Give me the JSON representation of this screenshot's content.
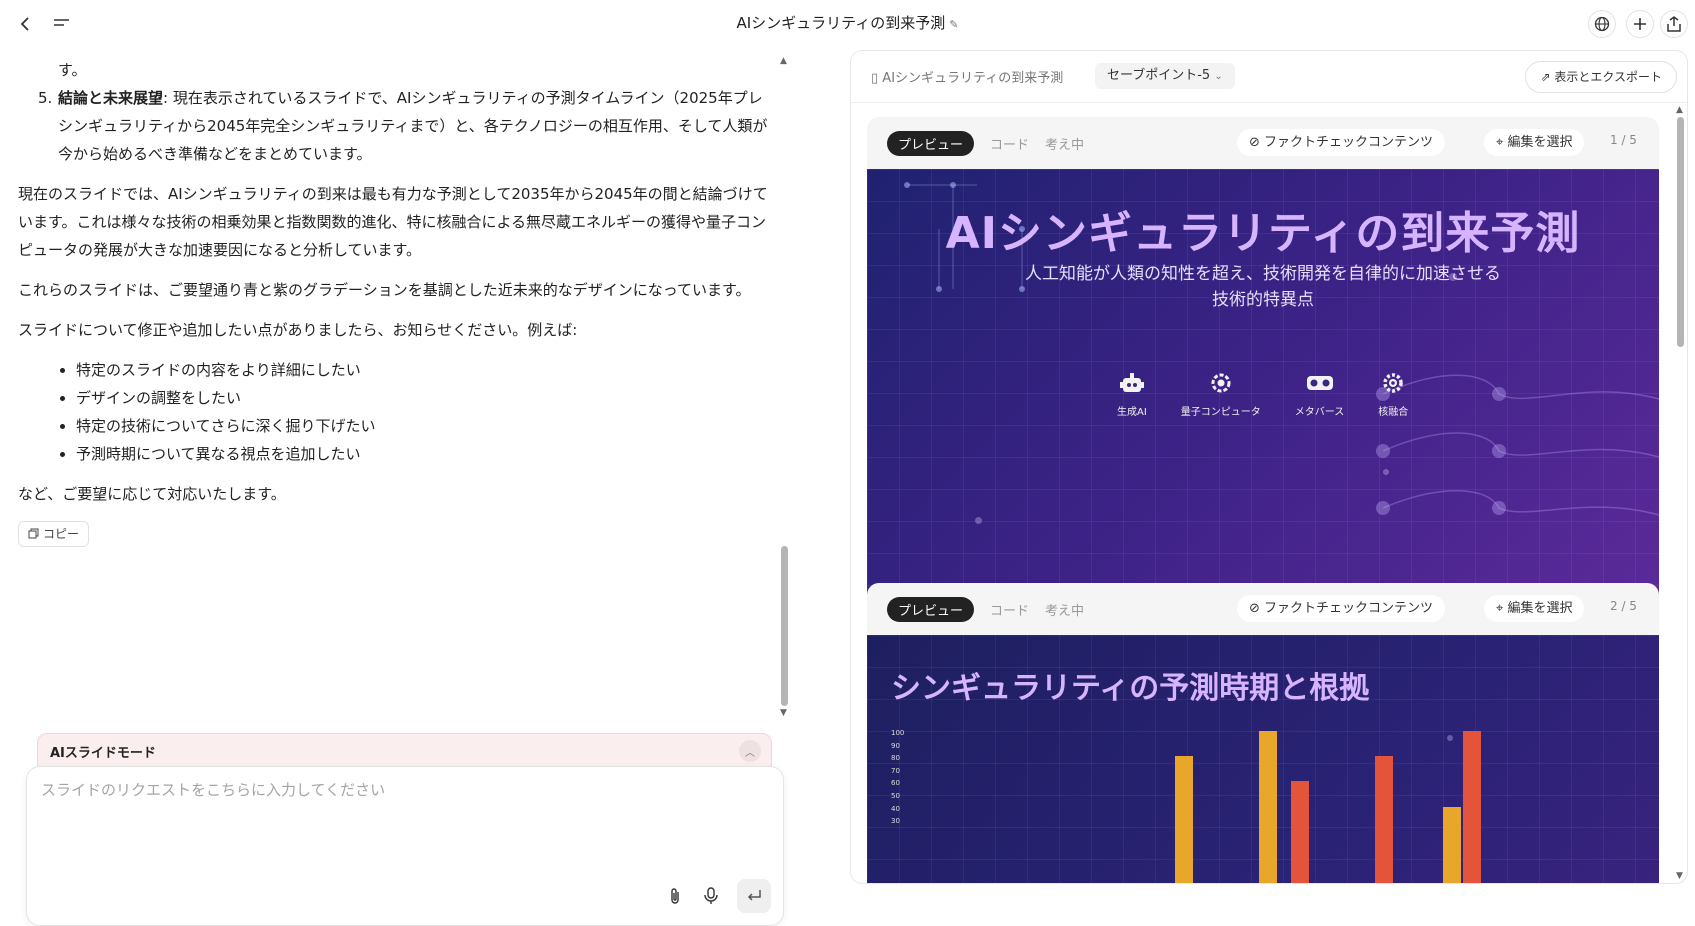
{
  "topbar": {
    "title": "AIシンギュラリティの到来予測",
    "back_icon": "chevron-left-icon",
    "menu_icon": "menu-icon",
    "globe_icon": "globe-icon",
    "plus_icon": "plus-icon",
    "share_icon": "share-icon"
  },
  "chat": {
    "prev_tail": "す。",
    "item5_num": "5.",
    "item5_bold": "結論と未来展望",
    "item5_text": ": 現在表示されているスライドで、AIシンギュラリティの予測タイムライン（2025年プレシンギュラリティから2045年完全シンギュラリティまで）と、各テクノロジーの相互作用、そして人類が今から始めるべき準備などをまとめています。",
    "para1": "現在のスライドでは、AIシンギュラリティの到来は最も有力な予測として2035年から2045年の間と結論づけています。これは様々な技術の相乗効果と指数関数的進化、特に核融合による無尽蔵エネルギーの獲得や量子コンピュータの発展が大きな加速要因になると分析しています。",
    "para2": "これらのスライドは、ご要望通り青と紫のグラデーションを基調とした近未来的なデザインになっています。",
    "para3": "スライドについて修正や追加したい点がありましたら、お知らせください。例えば:",
    "bullets": [
      "特定のスライドの内容をより詳細にしたい",
      "デザインの調整をしたい",
      "特定の技術についてさらに深く掘り下げたい",
      "予測時期について異なる視点を追加したい"
    ],
    "para4": "など、ご要望に応じて対応いたします。",
    "copy_label": "コピー"
  },
  "composer": {
    "mode_label": "AIスライドモード",
    "placeholder": "スライドのリクエストをこちらに入力してください"
  },
  "panel": {
    "doc_title": "AIシンギュラリティの到来予測",
    "savepoint": "セーブポイント-5",
    "export_label": "表示とエクスポート",
    "tab_preview": "プレビュー",
    "tab_code": "コード",
    "tab_thinking": "考え中",
    "fact_check": "ファクトチェックコンテンツ",
    "select_edit": "編集を選択",
    "page1": "1 / 5",
    "page2": "2 / 5"
  },
  "slide1": {
    "title": "AIシンギュラリティの到来予測",
    "sub1": "人工知能が人類の知性を超え、技術開発を自律的に加速させる",
    "sub2": "技術的特異点",
    "icons": [
      "生成AI",
      "量子コンピュータ",
      "メタバース",
      "核融合"
    ]
  },
  "slide2": {
    "title": "シンギュラリティの予測時期と根拠"
  },
  "chart_data": {
    "type": "bar",
    "y_ticks": [
      "100",
      "90",
      "80",
      "70",
      "60",
      "50",
      "40",
      "30"
    ],
    "ylim": [
      30,
      100
    ],
    "series": [
      {
        "color": "#e8a62a",
        "values": [
          80,
          100,
          40
        ]
      },
      {
        "color": "#e4543a",
        "values": [
          60,
          80,
          100
        ]
      }
    ]
  }
}
